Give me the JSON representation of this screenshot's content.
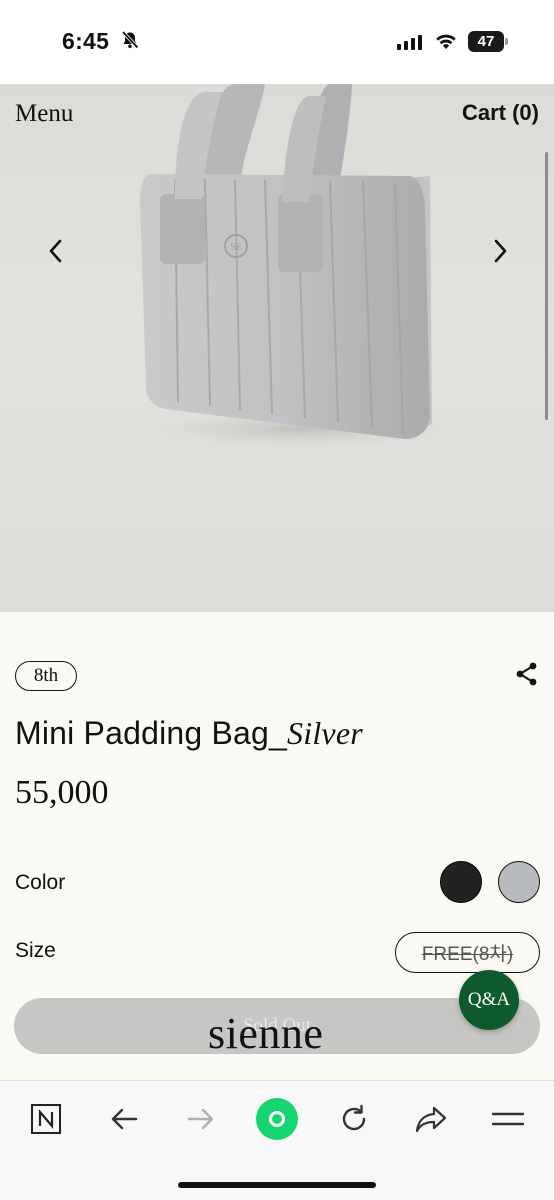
{
  "status_bar": {
    "time": "6:45",
    "battery": "47"
  },
  "header": {
    "menu_label": "Menu",
    "cart_label": "Cart (0)"
  },
  "product": {
    "badge": "8th",
    "name": "Mini Padding Bag_",
    "variant": "Silver",
    "price": "55,000",
    "color_label": "Color",
    "colors": [
      {
        "name": "black",
        "hex": "#222222"
      },
      {
        "name": "silver",
        "hex": "#b7bbbd"
      }
    ],
    "size_label": "Size",
    "size_option": "FREE(8차)",
    "buy_button": "Sold Out"
  },
  "brand": "sienne",
  "qa_button": "Q&A",
  "browser_toolbar": {
    "icons": [
      "naver-n-icon",
      "back-arrow-icon",
      "forward-arrow-icon",
      "green-dot-icon",
      "reload-icon",
      "share-icon",
      "menu-icon"
    ]
  }
}
